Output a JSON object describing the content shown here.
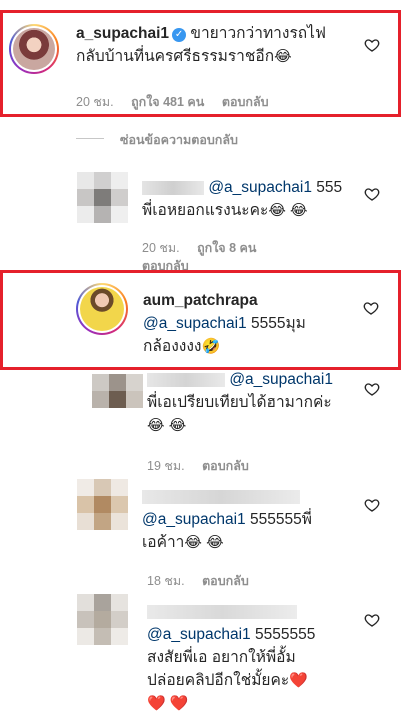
{
  "comments": [
    {
      "username": "a_supachai1",
      "verified": true,
      "text_line1": "ขายาวกว่าทางรถไฟ",
      "text_line2": "กลับบ้านที่นครศรีธรรมราชอีก",
      "emoji": "😂",
      "time": "20 ชม.",
      "likes": "ถูกใจ 481 คน",
      "reply": "ตอบกลับ"
    },
    {
      "hide_replies": "ซ่อนข้อความตอบกลับ"
    },
    {
      "mention": "@a_supachai1",
      "text_line1": "555",
      "text_line2": "พี่เอหยอกแรงนะคะ",
      "emoji": "😂 😂",
      "time": "20 ชม.",
      "likes": "ถูกใจ 8 คน",
      "reply": "ตอบกลับ"
    },
    {
      "username": "aum_patchrapa",
      "mention": "@a_supachai1",
      "text_line1": "5555มุม",
      "text_line2": "กล้องงงง",
      "emoji": "🤣"
    },
    {
      "mention": "@a_supachai1",
      "text_line2": "พี่เอเปรียบเทียบได้ฮามากค่ะ",
      "emoji": "😂 😂",
      "time": "19 ชม.",
      "reply": "ตอบกลับ"
    },
    {
      "mention": "@a_supachai1",
      "text_line1": "555555พี่",
      "text_line2": "เอค้าา",
      "emoji": "😂 😂",
      "time": "18 ชม.",
      "reply": "ตอบกลับ"
    },
    {
      "mention": "@a_supachai1",
      "text_line1": "5555555",
      "text_line2": "สงสัยพี่เอ อยากให้พี่อั้ม",
      "text_line3": "ปล่อยคลิปอีกใช่มั้ยคะ",
      "emoji": "❤️",
      "emoji2": "❤️ ❤️"
    }
  ],
  "colors": {
    "highlight": "#e5202b",
    "mention": "#00376b",
    "meta": "#8e8e8e"
  }
}
